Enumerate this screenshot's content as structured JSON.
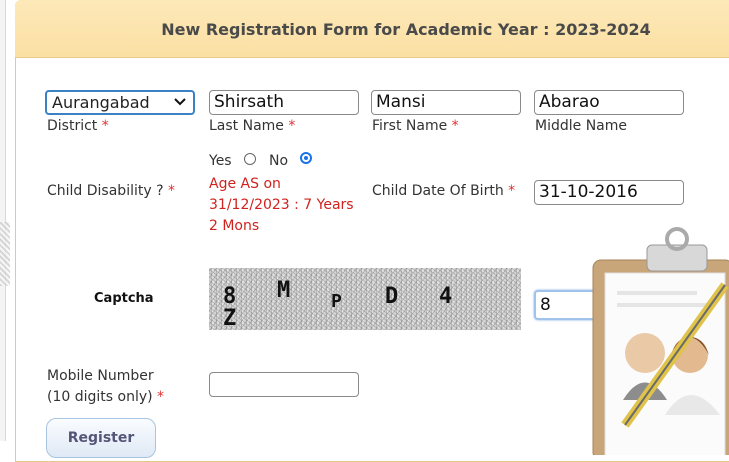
{
  "form": {
    "title": "New Registration Form for Academic Year : 2023-2024",
    "district": {
      "label": "District",
      "selected": "Aurangabad",
      "required": "*"
    },
    "last_name": {
      "label": "Last Name",
      "value": "Shirsath",
      "required": "*"
    },
    "first_name": {
      "label": "First Name",
      "value": "Mansi",
      "required": "*"
    },
    "middle_name": {
      "label": "Middle Name",
      "value": "Abarao"
    },
    "child_disability": {
      "label": "Child Disability ?",
      "required": "*",
      "yes_label": "Yes",
      "no_label": "No",
      "selected": "No"
    },
    "age_note": "Age AS on 31/12/2023 : 7 Years 2 Mons",
    "dob": {
      "label": "Child Date Of Birth",
      "value": "31-10-2016",
      "required": "*"
    },
    "captcha": {
      "label": "Captcha",
      "chars": [
        "8",
        "M",
        "P",
        "D",
        "4",
        "Z"
      ],
      "input_value": "8"
    },
    "mobile": {
      "label_line1": "Mobile Number",
      "label_line2": "(10 digits only)",
      "required": "*",
      "value": ""
    },
    "register_button": "Register"
  },
  "colors": {
    "header_bg": "#fce3aa",
    "required": "#e03030",
    "age_note": "#d0221e",
    "accent": "#1a73e8"
  }
}
